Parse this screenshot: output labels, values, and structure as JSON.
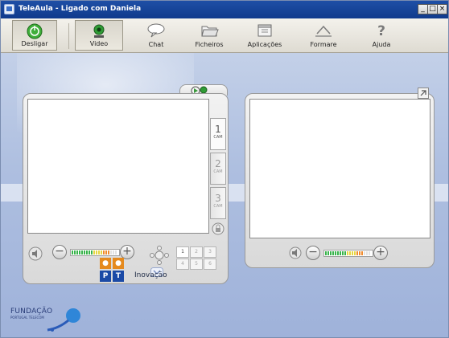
{
  "window": {
    "title": "TeleAula - Ligado com Daniela",
    "minimize": "_",
    "maximize": "□",
    "close": "×"
  },
  "toolbar": {
    "buttons": [
      {
        "id": "desligar",
        "label": "Desligar",
        "icon": "power-icon"
      },
      {
        "id": "video",
        "label": "Video",
        "icon": "webcam-icon"
      },
      {
        "id": "chat",
        "label": "Chat",
        "icon": "speech-bubble-icon"
      },
      {
        "id": "ficheiros",
        "label": "Ficheiros",
        "icon": "folder-icon"
      },
      {
        "id": "aplicacoes",
        "label": "Aplicações",
        "icon": "applications-icon"
      },
      {
        "id": "formare",
        "label": "Formare",
        "icon": "formare-icon"
      },
      {
        "id": "ajuda",
        "label": "Ajuda",
        "icon": "help-icon"
      }
    ]
  },
  "local_video": {
    "cameras": [
      {
        "num": "1",
        "label": "CAM"
      },
      {
        "num": "2",
        "label": "CAM"
      },
      {
        "num": "3",
        "label": "CAM"
      }
    ],
    "numpad": [
      "1",
      "2",
      "3",
      "4",
      "5",
      "6"
    ],
    "volume_minus": "−",
    "volume_plus": "+"
  },
  "remote_video": {
    "volume_minus": "−",
    "volume_plus": "+"
  },
  "footer": {
    "fundacao": "FUNDAÇÃO",
    "fundacao_sub": "PORTUGAL TELECOM",
    "pt_letters": [
      "P",
      "T"
    ],
    "inovacao": "Inovação"
  },
  "colors": {
    "titlebar": "#1f4fa6",
    "background": "#aebfe0",
    "meter_green": "#37b34a",
    "meter_yellow": "#e6d640",
    "meter_orange": "#f08a2b"
  }
}
